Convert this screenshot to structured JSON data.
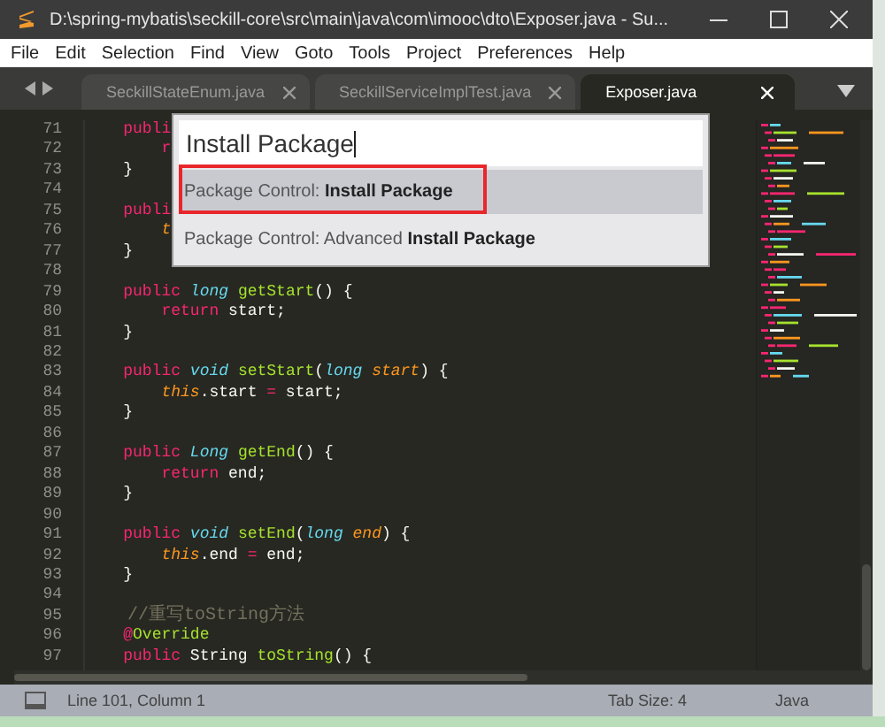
{
  "window": {
    "title": "D:\\spring-mybatis\\seckill-core\\src\\main\\java\\com\\imooc\\dto\\Exposer.java - Su..."
  },
  "menu": [
    "File",
    "Edit",
    "Selection",
    "Find",
    "View",
    "Goto",
    "Tools",
    "Project",
    "Preferences",
    "Help"
  ],
  "tabs": [
    {
      "label": "SeckillStateEnum.java",
      "selected": false
    },
    {
      "label": "SeckillServiceImplTest.java",
      "selected": false
    },
    {
      "label": "Exposer.java",
      "selected": true
    }
  ],
  "code_lines": [
    {
      "number": "71",
      "segments": [
        {
          "kind": "keyword",
          "text": "    publi"
        }
      ]
    },
    {
      "number": "72",
      "segments": [
        {
          "kind": "keyword",
          "text": "        r"
        }
      ]
    },
    {
      "number": "73",
      "segments": [
        {
          "kind": "plain",
          "text": "    }"
        }
      ]
    },
    {
      "number": "74"
    },
    {
      "number": "75",
      "segments": [
        {
          "kind": "keyword",
          "text": "    publi"
        }
      ]
    },
    {
      "number": "76",
      "segments": [
        {
          "kind": "self",
          "text": "        t"
        }
      ]
    },
    {
      "number": "77",
      "segments": [
        {
          "kind": "plain",
          "text": "    }"
        }
      ]
    },
    {
      "number": "78"
    },
    {
      "number": "79",
      "segments": [
        {
          "kind": "keyword",
          "text": "    public "
        },
        {
          "kind": "type",
          "text": "long "
        },
        {
          "kind": "function",
          "text": "getStart"
        },
        {
          "kind": "plain",
          "text": "() {"
        }
      ]
    },
    {
      "number": "80",
      "segments": [
        {
          "kind": "keyword",
          "text": "        return"
        },
        {
          "kind": "plain",
          "text": " start;"
        }
      ]
    },
    {
      "number": "81",
      "segments": [
        {
          "kind": "plain",
          "text": "    }"
        }
      ]
    },
    {
      "number": "82"
    },
    {
      "number": "83",
      "segments": [
        {
          "kind": "keyword",
          "text": "    public "
        },
        {
          "kind": "type",
          "text": "void "
        },
        {
          "kind": "function",
          "text": "setStart"
        },
        {
          "kind": "plain",
          "text": "("
        },
        {
          "kind": "type",
          "text": "long "
        },
        {
          "kind": "param",
          "text": "start"
        },
        {
          "kind": "plain",
          "text": ") {"
        }
      ]
    },
    {
      "number": "84",
      "segments": [
        {
          "kind": "self",
          "text": "        this"
        },
        {
          "kind": "plain",
          "text": ".start "
        },
        {
          "kind": "keyword",
          "text": "="
        },
        {
          "kind": "plain",
          "text": " start;"
        }
      ]
    },
    {
      "number": "85",
      "segments": [
        {
          "kind": "plain",
          "text": "    }"
        }
      ]
    },
    {
      "number": "86"
    },
    {
      "number": "87",
      "segments": [
        {
          "kind": "keyword",
          "text": "    public "
        },
        {
          "kind": "type",
          "text": "Long "
        },
        {
          "kind": "function",
          "text": "getEnd"
        },
        {
          "kind": "plain",
          "text": "() {"
        }
      ]
    },
    {
      "number": "88",
      "segments": [
        {
          "kind": "keyword",
          "text": "        return"
        },
        {
          "kind": "plain",
          "text": " end;"
        }
      ]
    },
    {
      "number": "89",
      "segments": [
        {
          "kind": "plain",
          "text": "    }"
        }
      ]
    },
    {
      "number": "90"
    },
    {
      "number": "91",
      "segments": [
        {
          "kind": "keyword",
          "text": "    public "
        },
        {
          "kind": "type",
          "text": "void "
        },
        {
          "kind": "function",
          "text": "setEnd"
        },
        {
          "kind": "plain",
          "text": "("
        },
        {
          "kind": "type",
          "text": "long "
        },
        {
          "kind": "param",
          "text": "end"
        },
        {
          "kind": "plain",
          "text": ") {"
        }
      ]
    },
    {
      "number": "92",
      "segments": [
        {
          "kind": "self",
          "text": "        this"
        },
        {
          "kind": "plain",
          "text": ".end "
        },
        {
          "kind": "keyword",
          "text": "="
        },
        {
          "kind": "plain",
          "text": " end;"
        }
      ]
    },
    {
      "number": "93",
      "segments": [
        {
          "kind": "plain",
          "text": "    }"
        }
      ]
    },
    {
      "number": "94"
    },
    {
      "number": "95",
      "segments": [
        {
          "kind": "comment",
          "text": "    //重写toString方法"
        }
      ]
    },
    {
      "number": "96",
      "segments": [
        {
          "kind": "keyword",
          "text": "    @"
        },
        {
          "kind": "annotation",
          "text": "Override"
        }
      ]
    },
    {
      "number": "97",
      "segments": [
        {
          "kind": "keyword",
          "text": "    public "
        },
        {
          "kind": "plain",
          "text": "String "
        },
        {
          "kind": "function",
          "text": "toString"
        },
        {
          "kind": "plain",
          "text": "() {"
        }
      ]
    }
  ],
  "command_palette": {
    "value": "Install Package",
    "items": [
      {
        "text": "Package Control: **Install Package**",
        "selected": true,
        "highlighted": true
      },
      {
        "text": "Package Control: Advanced **Install Package**",
        "selected": false,
        "highlighted": false
      }
    ]
  },
  "status_bar": {
    "position": "Line 101, Column 1",
    "tab_size": "Tab Size: 4",
    "syntax": "Java"
  }
}
